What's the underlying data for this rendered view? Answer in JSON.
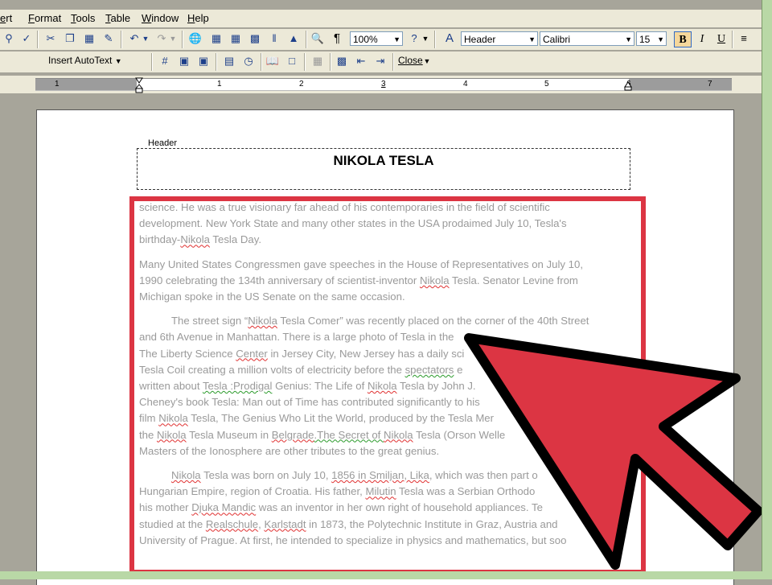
{
  "menu": {
    "items": [
      "ert",
      "Format",
      "Tools",
      "Table",
      "Window",
      "Help"
    ]
  },
  "toolbar": {
    "zoom": "100%",
    "style": "Header",
    "font": "Calibri",
    "size": "15",
    "bold": "B",
    "italic": "I",
    "underline": "U",
    "pilcrow": "¶"
  },
  "header_toolbar": {
    "insert_autotext": "Insert AutoText",
    "close": "Close"
  },
  "ruler": {
    "numbers": [
      "1",
      "1",
      "2",
      "3",
      "4",
      "5",
      "6",
      "7"
    ]
  },
  "document": {
    "header_label": "Header",
    "title": "NIKOLA TESLA",
    "p1": {
      "l1": "science. He was a true visionary far ahead of his contemporaries in the field of scientific",
      "l2": "development. New York State and many other states in the USA prodaimed July 10, Tesla's",
      "l3a": "birthday-",
      "l3b": "Nikola",
      "l3c": " Tesla Day."
    },
    "p2": {
      "l1": "Many United States Congressmen gave speeches in the House of Representatives on July 10,",
      "l2a": "1990 celebrating the 134th anniversary of scientist-inventor ",
      "l2b": "Nikola",
      "l2c": " Tesla. Senator Levine from",
      "l3": "Michigan spoke in the US Senate on the same occasion."
    },
    "p3": {
      "l1a": "The street sign “",
      "l1b": "Nikola",
      "l1c": " Tesla Comer” was recently placed on the corner of the 40th Street",
      "l2": "and 6th Avenue in Manhattan. There is a large photo of Tesla in the",
      "l3a": "The Liberty Science ",
      "l3b": "Center",
      "l3c": " in Jersey City, New Jersey has a daily sci",
      "l4a": "Tesla Coil creating a million volts of electricity before the ",
      "l4b": "spectators",
      "l4c": " e",
      "l5a": "written about ",
      "l5b": "Tesla :Prodigal",
      "l5c": " Genius: The Life of ",
      "l5d": "Nikola",
      "l5e": " Tesla by John J.",
      "l6": "Cheney's book Tesla: Man out of Time has contributed significantly to his",
      "l7a": "film ",
      "l7b": "Nikola",
      "l7c": " Tesla, The Genius Who Lit the World, produced by the Tesla Mer",
      "l8a": "the ",
      "l8b": "Nikola",
      "l8c": " Tesla Museum in ",
      "l8d": "Belgrade",
      "l8e": ".The Secret of ",
      "l8f": "Nikola",
      "l8g": " Tesla (Orson Welle",
      "l9": "Masters of the Ionosphere are other tributes to the great genius."
    },
    "p4": {
      "l1a": "Nikola",
      "l1b": " Tesla was born on July 10, ",
      "l1c": "1856 in Smiljan, Lika",
      "l1d": ", which was then part o",
      "l2": "Hungarian Empire, region of Croatia. His father, ",
      "l2b": "Milutin",
      "l2c": " Tesla was a Serbian Orthodo",
      "l3a": "his mother ",
      "l3b": "Djuka Mandic",
      "l3c": " was an inventor in her own right of household appliances. Te",
      "l4a": "studied at the ",
      "l4b": "Realschule",
      "l4c": ", ",
      "l4d": "Karlstadt",
      "l4e": " in 1873, the Polytechnic Institute in Graz, Austria and",
      "l5": "University of Prague. At first, he intended to specialize in physics and mathematics, but soo"
    }
  },
  "colors": {
    "highlight": "#dc3543",
    "arrow_fill": "#dc3543",
    "arrow_outline": "#000000"
  }
}
